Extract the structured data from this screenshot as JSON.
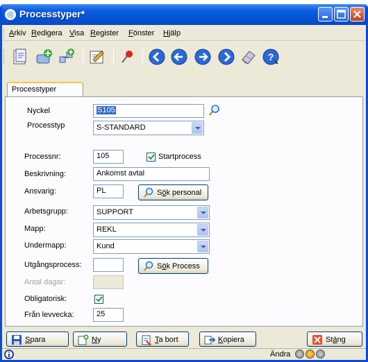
{
  "window": {
    "title": "Processtyper*"
  },
  "menu": {
    "items": [
      {
        "pre": "",
        "accel": "A",
        "post": "rkiv"
      },
      {
        "pre": "",
        "accel": "R",
        "post": "edigera"
      },
      {
        "pre": "",
        "accel": "V",
        "post": "isa"
      },
      {
        "pre": "",
        "accel": "R",
        "post": "egister"
      },
      {
        "pre": "",
        "accel": "F",
        "post": "önster"
      },
      {
        "pre": "",
        "accel": "H",
        "post": "jälp"
      }
    ]
  },
  "toolbar": {
    "tools": [
      "new-document-icon",
      "add-item-icon",
      "add-flow-icon",
      "edit-icon",
      "pin-icon",
      "first-icon",
      "previous-icon",
      "next-icon",
      "last-icon",
      "eraser-icon",
      "help-icon"
    ]
  },
  "tab": {
    "label": "Processtyper"
  },
  "form": {
    "nyckel": {
      "label": "Nyckel",
      "value": "S105"
    },
    "processtyp": {
      "label": "Processtyp",
      "value": "S-STANDARD"
    },
    "processnr": {
      "label": "Processnr:",
      "value": "105"
    },
    "startprocess": {
      "label": "Startprocess",
      "checked": true
    },
    "beskrivning": {
      "label": "Beskrivning:",
      "value": "Ankomst avtal"
    },
    "ansvarig": {
      "label": "Ansvarig:",
      "value": "PL"
    },
    "sok_personal": {
      "pre": "S",
      "accel": "ö",
      "post": "k personal"
    },
    "arbetsgrupp": {
      "label": "Arbetsgrupp:",
      "value": "SUPPORT"
    },
    "mapp": {
      "label": "Mapp:",
      "value": "REKL"
    },
    "undermapp": {
      "label": "Undermapp:",
      "value": "Kund"
    },
    "utgangsprocess": {
      "label": "Utgångsprocess:",
      "value": ""
    },
    "sok_process": {
      "pre": "S",
      "accel": "ö",
      "post": "k Process"
    },
    "antal_dagar": {
      "label": "Antal dagar:",
      "value": ""
    },
    "obligatorisk": {
      "label": "Obligatorisk:",
      "checked": true
    },
    "fran_levvecka": {
      "label": "Från levvecka:",
      "value": "25"
    }
  },
  "buttons": {
    "spara": {
      "pre": "",
      "accel": "S",
      "post": "para"
    },
    "ny": {
      "pre": "",
      "accel": "N",
      "post": "y"
    },
    "ta_bort": {
      "pre": "",
      "accel": "T",
      "post": "a bort"
    },
    "kopiera": {
      "pre": "",
      "accel": "K",
      "post": "opiera"
    },
    "stang": {
      "pre": "St",
      "accel": "ä",
      "post": "ng"
    }
  },
  "status": {
    "mode": "Ändra"
  }
}
